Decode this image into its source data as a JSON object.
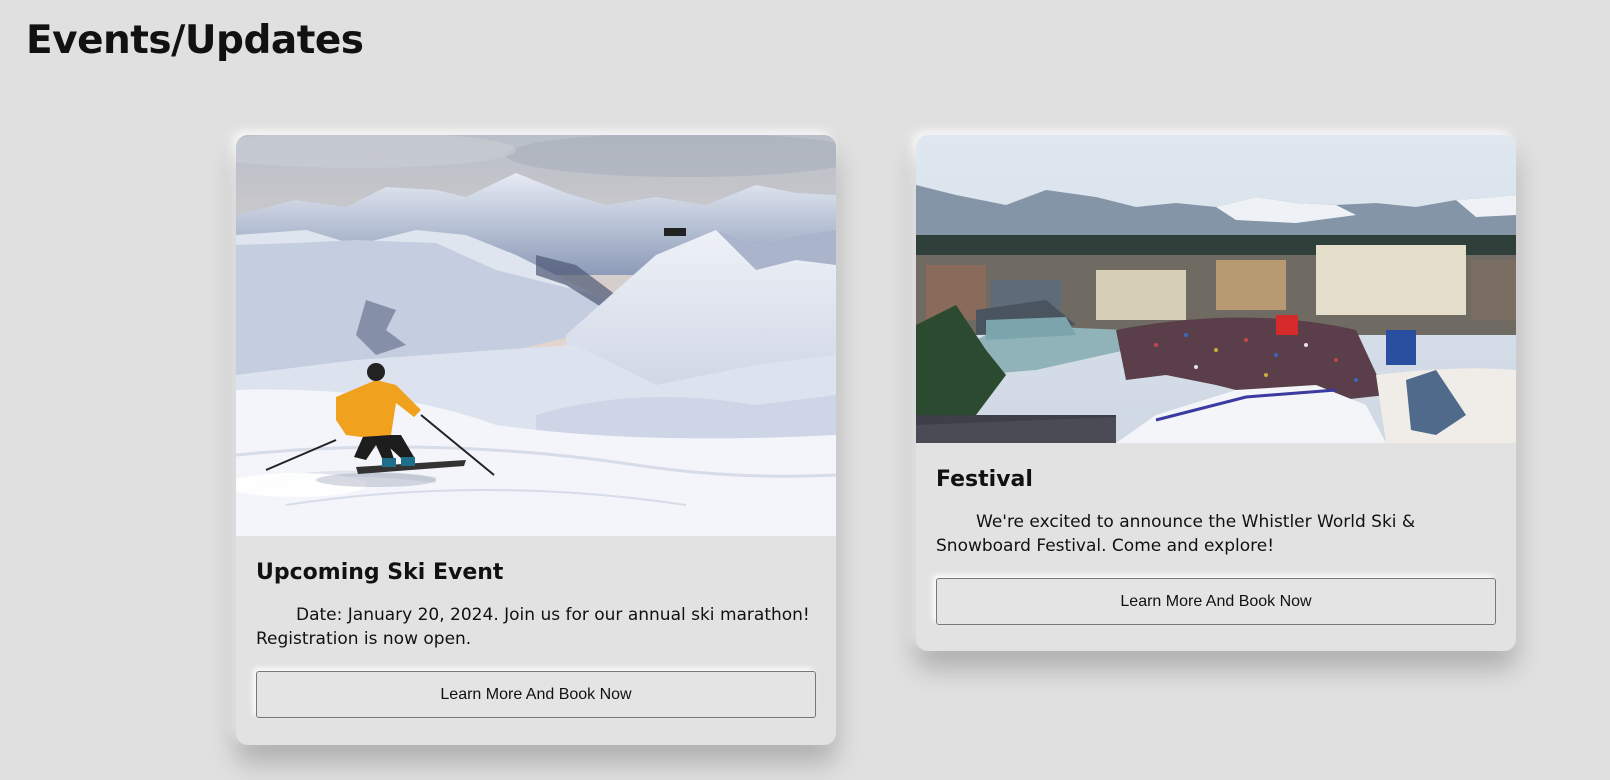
{
  "page": {
    "title": "Events/Updates"
  },
  "events": [
    {
      "title": "Upcoming Ski Event",
      "description": "Date: January 20, 2024. Join us for our annual ski marathon! Registration is now open.",
      "button_label": "Learn More And Book Now",
      "image": "skier-on-mountain-slope"
    },
    {
      "title": "Festival",
      "description": "We're excited to announce the Whistler World Ski & Snowboard Festival. Come and explore!",
      "button_label": "Learn More And Book Now",
      "image": "ski-village-festival-crowd"
    }
  ],
  "colors": {
    "background": "#e0e0e0",
    "card": "#e2e2e2",
    "skier_jacket": "#f0a21e"
  }
}
